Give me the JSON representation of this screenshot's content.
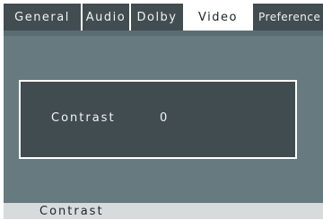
{
  "tabs": [
    {
      "label": "General"
    },
    {
      "label": "Audio"
    },
    {
      "label": "Dolby"
    },
    {
      "label": "Video"
    },
    {
      "label": "Preference"
    }
  ],
  "active_tab": "Video",
  "setting": {
    "name": "Contrast",
    "value": "0"
  },
  "status_bar": {
    "text": "Contrast"
  },
  "colors": {
    "tab_bar": "#424d51",
    "main_background": "#667a80",
    "setting_box": "#414c50",
    "status_bar": "#d7dbdc",
    "active_tab": "#ffffff"
  }
}
